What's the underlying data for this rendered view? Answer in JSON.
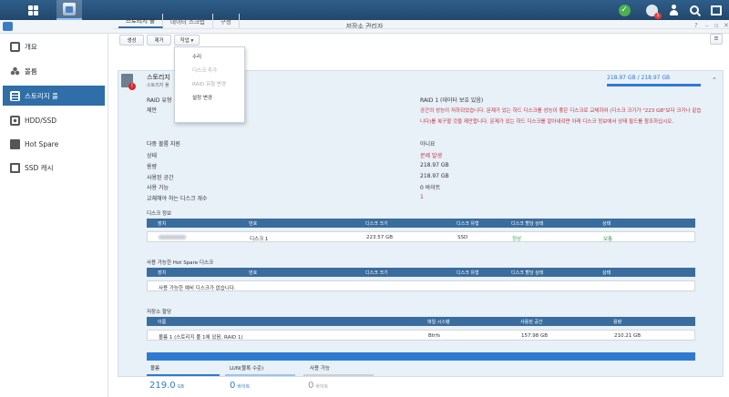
{
  "window": {
    "title": "저장소 관리자"
  },
  "sidebar": {
    "items": [
      {
        "label": "개요"
      },
      {
        "label": "볼륨"
      },
      {
        "label": "스토리지 풀"
      },
      {
        "label": "HDD/SSD"
      },
      {
        "label": "Hot Spare"
      },
      {
        "label": "SSD 캐시"
      }
    ]
  },
  "tabs": [
    "스토리지 풀",
    "데이터 스크럽",
    "구성"
  ],
  "toolbar": {
    "create": "생성",
    "remove": "제거",
    "action": "작업 ▾"
  },
  "dropdown": [
    "수리",
    "디스크 추가",
    "RAID 유형 변경",
    "설정 변경"
  ],
  "pool": {
    "name": "스토리지",
    "sub": "스토리지 풀",
    "usage": "218.97 GB / 218.97 GB",
    "raid_label": "RAID 유형",
    "raid_value": "RAID 1 (데이터 보호 있음)",
    "suggest_label": "제안",
    "suggest_text": "공간의 성능이 저하되었습니다. 문제가 있는 하드 디스크를 성능이 좋은 디스크로 교체하여 (디스크 크기가 \"223 GB\"보다 크거나 같습니다)를 복구할 것을 제안합니다. 문제가 있는 하드 디스크를 알아내려면 아래 디스크 정보에서 상태 필드를 참조하십시오.",
    "multi_label": "다중 볼륨 지원",
    "multi_value": "아니요",
    "status_label": "상태",
    "status_value": "문제 발생",
    "capacity_label": "용량",
    "capacity_value": "218.97 GB",
    "used_label": "사용된 공간",
    "used_value": "218.97 GB",
    "avail_label": "사용 가능",
    "avail_value": "0 바이트",
    "replace_label": "교체해야 하는 디스크 개수",
    "replace_value": "1"
  },
  "disk_info": {
    "title": "디스크 정보",
    "headers": [
      "장치",
      "번호",
      "디스크 크기",
      "디스크 유형",
      "디스크 할당 상태",
      "상태"
    ],
    "row": [
      "디스크 1",
      "223.57 GB",
      "SSD",
      "정상",
      "보통"
    ]
  },
  "hotspare": {
    "title": "사용 가능한 Hot Spare 디스크",
    "headers": [
      "장치",
      "번호",
      "디스크 크기",
      "디스크 유형",
      "디스크 할당 상태",
      "상태"
    ],
    "empty": "사용 가능한 예비 디스크가 없습니다."
  },
  "alloc": {
    "title": "저장소 할당",
    "headers": [
      "이름",
      "파일 시스템",
      "사용된 공간",
      "용량"
    ],
    "row": [
      "볼륨 1 (스토리지 풀 1에 있음, RAID 1)",
      "Btrfs",
      "157.98 GB",
      "210.21 GB"
    ]
  },
  "stats": [
    {
      "label": "볼륨",
      "value": "219.0",
      "unit": "GB"
    },
    {
      "label": "LUN(블록 수준)",
      "value": "0",
      "unit": "바이트"
    },
    {
      "label": "사용 가능",
      "value": "0",
      "unit": "바이트"
    }
  ]
}
